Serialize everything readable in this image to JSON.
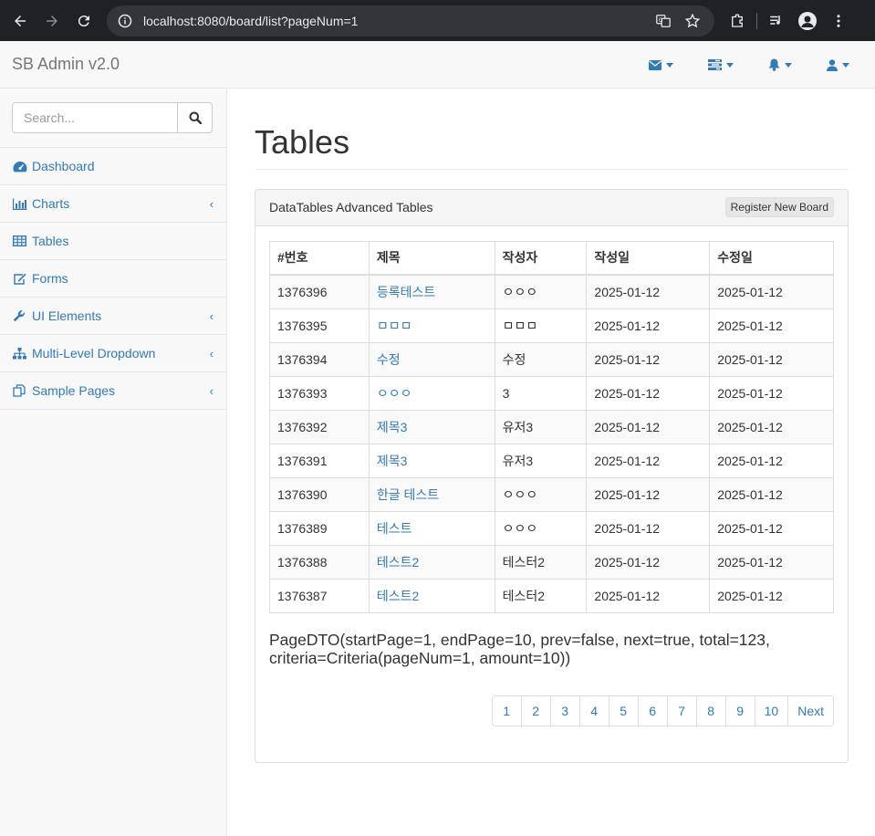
{
  "browser": {
    "url": "localhost:8080/board/list?pageNum=1"
  },
  "app": {
    "brand": "SB Admin v2.0"
  },
  "sidebar": {
    "search_placeholder": "Search...",
    "items": [
      {
        "label": "Dashboard",
        "icon": "dashboard-icon",
        "has_arrow": false
      },
      {
        "label": "Charts",
        "icon": "bar-chart-icon",
        "has_arrow": true
      },
      {
        "label": "Tables",
        "icon": "table-icon",
        "has_arrow": false
      },
      {
        "label": "Forms",
        "icon": "edit-icon",
        "has_arrow": false
      },
      {
        "label": "UI Elements",
        "icon": "wrench-icon",
        "has_arrow": true
      },
      {
        "label": "Multi-Level Dropdown",
        "icon": "sitemap-icon",
        "has_arrow": true
      },
      {
        "label": "Sample Pages",
        "icon": "files-icon",
        "has_arrow": true
      }
    ]
  },
  "main": {
    "title": "Tables",
    "panel_title": "DataTables Advanced Tables",
    "register_button": "Register New Board",
    "table": {
      "headers": [
        "#번호",
        "제목",
        "작성자",
        "작성일",
        "수정일"
      ],
      "rows": [
        [
          "1376396",
          "등록테스트",
          "ㅇㅇㅇ",
          "2025-01-12",
          "2025-01-12"
        ],
        [
          "1376395",
          "ㅁㅁㅁ",
          "ㅁㅁㅁ",
          "2025-01-12",
          "2025-01-12"
        ],
        [
          "1376394",
          "수정",
          "수정",
          "2025-01-12",
          "2025-01-12"
        ],
        [
          "1376393",
          "ㅇㅇㅇ",
          "3",
          "2025-01-12",
          "2025-01-12"
        ],
        [
          "1376392",
          "제목3",
          "유저3",
          "2025-01-12",
          "2025-01-12"
        ],
        [
          "1376391",
          "제목3",
          "유저3",
          "2025-01-12",
          "2025-01-12"
        ],
        [
          "1376390",
          "한글 테스트",
          "ㅇㅇㅇ",
          "2025-01-12",
          "2025-01-12"
        ],
        [
          "1376389",
          "테스트",
          "ㅇㅇㅇ",
          "2025-01-12",
          "2025-01-12"
        ],
        [
          "1376388",
          "테스트2",
          "테스터2",
          "2025-01-12",
          "2025-01-12"
        ],
        [
          "1376387",
          "테스트2",
          "테스터2",
          "2025-01-12",
          "2025-01-12"
        ]
      ]
    },
    "pagedto_line1": "PageDTO(startPage=1, endPage=10, prev=false, next=true, total=123,",
    "pagedto_line2": "criteria=Criteria(pageNum=1, amount=10))",
    "pagination": [
      "1",
      "2",
      "3",
      "4",
      "5",
      "6",
      "7",
      "8",
      "9",
      "10",
      "Next"
    ]
  },
  "colors": {
    "link": "#337ab7",
    "chrome_bg": "#202124"
  }
}
